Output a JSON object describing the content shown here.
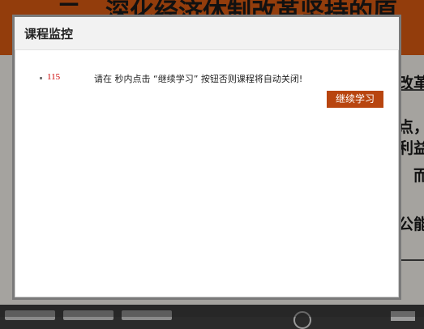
{
  "background": {
    "heading": "二、深化经济体制改革坚持的原",
    "right_lines": [
      "改革",
      "点，",
      "利益",
      "而",
      "公能"
    ]
  },
  "dialog": {
    "title": "课程监控",
    "countdown": "115",
    "message": "请在  秒内点击 “继续学习” 按钮否则课程将自动关闭!",
    "continue_label": "继续学习"
  },
  "colors": {
    "header_orange": "#d95a12",
    "button": "#b8450f",
    "countdown": "#cc0000"
  }
}
